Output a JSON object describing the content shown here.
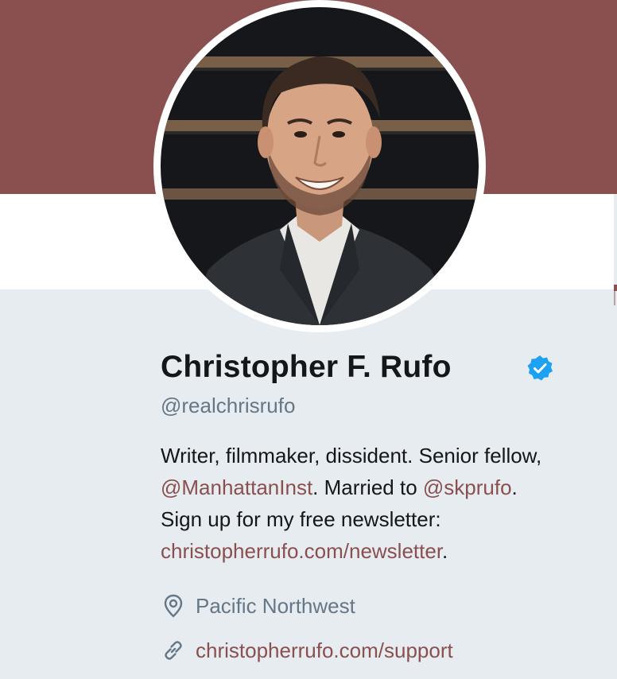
{
  "profile": {
    "display_name": "Christopher F. Rufo",
    "verified_icon": "verified-badge-icon",
    "handle": "@realchrisrufo",
    "bio": {
      "line1": "Writer, filmmaker, dissident. Senior fellow,",
      "mention1": "@ManhattanInst",
      "mid": ". Married to ",
      "mention2": "@skprufo",
      "end1": ".",
      "line3": "Sign up for my free newsletter:",
      "link": "christopherrufo.com/newsletter",
      "end2": "."
    },
    "location": "Pacific Northwest",
    "location_icon": "location-pin-icon",
    "website": "christopherrufo.com/support",
    "website_icon": "link-icon"
  },
  "colors": {
    "banner": "#8a4f4f",
    "link": "#8a4f4f",
    "background": "#e6ecf0",
    "verified": "#1da1f2",
    "secondary_text": "#657786"
  }
}
